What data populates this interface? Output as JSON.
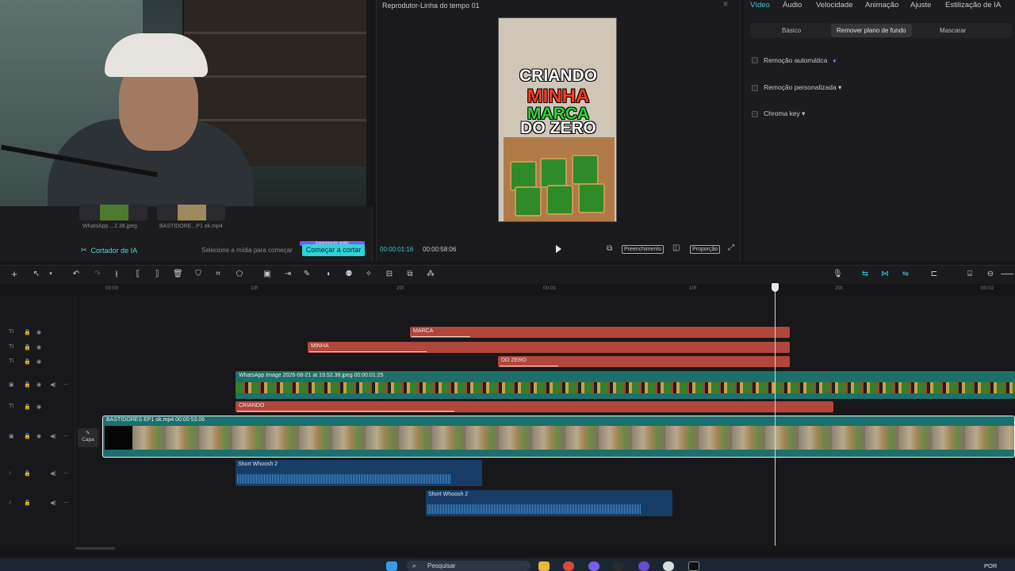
{
  "webcam": {
    "label": ""
  },
  "media": {
    "thumbs": [
      {
        "label": "WhatsApp ...2.38.jpeg"
      },
      {
        "label": "BASTIDORE...P1 ok.mp4"
      }
    ],
    "ai_cutter_label": "Cortador de IA",
    "ai_hint": "Selecione a mídia para começar",
    "ai_button": "Começar a cortar",
    "ai_badge": "Experimente grátis"
  },
  "player": {
    "title": "Reprodutor-Linha do tempo 01",
    "menu_glyph": "≡",
    "current_time": "00:00:01:16",
    "total_time": "00:00:58:06",
    "fill_label": "Preenchimento",
    "ratio_label": "Proporção",
    "video_text": [
      "CRIANDO",
      "MINHA",
      "MARCA",
      "DO ZERO"
    ]
  },
  "inspector": {
    "tabs": [
      "Vídeo",
      "Áudio",
      "Velocidade",
      "Animação",
      "Ajuste",
      "Estilização de IA"
    ],
    "active_tab": "Vídeo",
    "subtabs": [
      "Básico",
      "Remover plano de fundo",
      "Mascarar"
    ],
    "options": [
      "Remoção automática",
      "Remoção personalizada ▾",
      "Chroma key ▾"
    ]
  },
  "ruler": {
    "ticks": [
      "00:00",
      "10f",
      "20f",
      "00:01",
      "10f",
      "20f",
      "00:02"
    ]
  },
  "timeline": {
    "text_clips": [
      "MARCA",
      "MINHA",
      "DO ZERO",
      "CRIANDO"
    ],
    "image_clip_label": "WhatsApp Image 2026-08-21 at 19.52.38.jpeg  00:00:01:25",
    "main_clip_label": "BASTIDORES EP1 ok.mp4   00:00:53:06",
    "cover_label": "Capa",
    "audio_clips": [
      "Short Whoosh 2",
      "Short Whoosh 2"
    ]
  },
  "taskbar": {
    "search_placeholder": "Pesquisar",
    "language": "POR"
  },
  "colors": {
    "accent": "#39c7d0",
    "text_clip": "#b1463b",
    "video_clip": "#1b6f6c",
    "audio_clip": "#173d66"
  }
}
